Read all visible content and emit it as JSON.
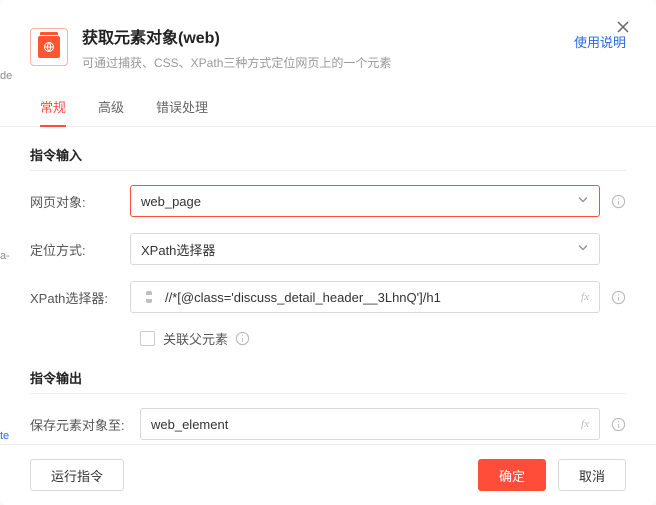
{
  "header": {
    "title": "获取元素对象(web)",
    "subtitle": "可通过捕获、CSS、XPath三种方式定位网页上的一个元素",
    "help_link": "使用说明"
  },
  "tabs": [
    {
      "label": "常规",
      "active": true
    },
    {
      "label": "高级",
      "active": false
    },
    {
      "label": "错误处理",
      "active": false
    }
  ],
  "sections": {
    "input_title": "指令输入",
    "output_title": "指令输出"
  },
  "fields": {
    "web_object": {
      "label": "网页对象:",
      "value": "web_page"
    },
    "locate_mode": {
      "label": "定位方式:",
      "value": "XPath选择器"
    },
    "xpath": {
      "label": "XPath选择器:",
      "value": "//*[@class='discuss_detail_header__3LhnQ']/h1"
    },
    "relate_parent": {
      "label": "关联父元素"
    },
    "save_to": {
      "label": "保存元素对象至:",
      "value": "web_element"
    }
  },
  "footer": {
    "run": "运行指令",
    "ok": "确定",
    "cancel": "取消"
  },
  "fx_label": "fx",
  "ghost": {
    "a": "de",
    "b": "a-",
    "c": "te"
  }
}
